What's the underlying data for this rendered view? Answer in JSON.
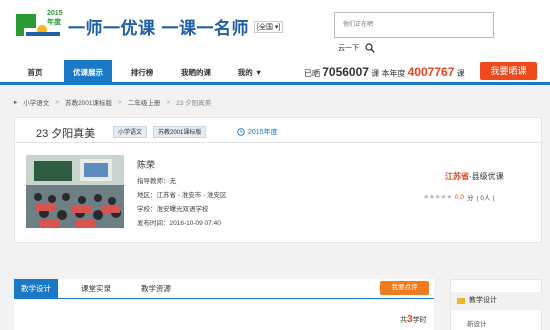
{
  "header": {
    "logo_year": "2015年度",
    "slogan_a": "一师一优课",
    "slogan_b": "一课一名师",
    "region": "[全国 ▾]",
    "search_placeholder": "他们正在晒",
    "search_label": "云一下"
  },
  "nav": {
    "items": [
      "首页",
      "优课展示",
      "排行榜",
      "我晒的课",
      "我的 ▼"
    ],
    "stat_prefix": "已晒",
    "stat_total": "7056007",
    "stat_unit1": "课",
    "stat_year_label": "本年度",
    "stat_year": "4007767",
    "stat_unit2": "课",
    "cta": "我要晒课"
  },
  "breadcrumb": [
    "小学语文",
    "苏教2001课标版",
    "二年级上册",
    "23 夕阳真美"
  ],
  "lesson": {
    "title": "23  夕阳真美",
    "tags": [
      "小学语文",
      "苏教2001课标版"
    ],
    "year": "2015年度"
  },
  "teacher": {
    "name": "陈荣",
    "mentor": "指导教师：无",
    "area": "地区：江苏省 - 淮安市 - 淮安区",
    "school": "学校：淮安曙光双语学校",
    "published": "发布时间：2016-10-09 07:40"
  },
  "award": {
    "province": "江苏省",
    "level": "·县级优课"
  },
  "rating": {
    "stars": "★★★★★",
    "score": "0.0",
    "unit": "分",
    "count": "( 0人 )"
  },
  "tabs": [
    "教学设计",
    "课堂实录",
    "教学资源"
  ],
  "review_button": "我要点评",
  "hours": {
    "prefix": "共",
    "value": "3",
    "suffix": "学时"
  },
  "sidebar": {
    "header": "教学设计",
    "sub": "新设计"
  },
  "colors": {
    "accent": "#1a79c7",
    "brand_orange": "#f04a1c",
    "highlight_red": "#e8431b"
  }
}
